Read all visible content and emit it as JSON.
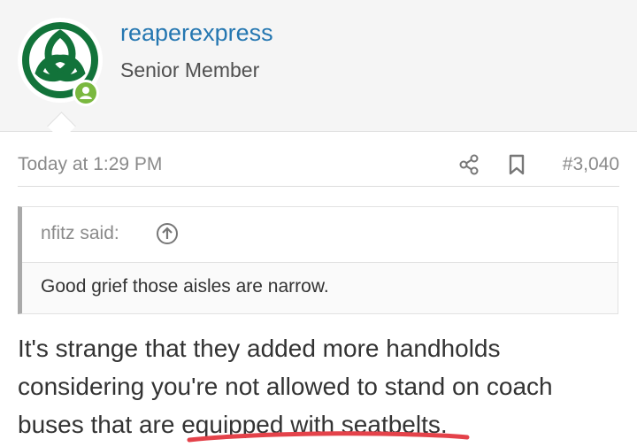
{
  "user": {
    "username": "reaperexpress",
    "title": "Senior Member",
    "avatar_icon": "green-triquetra-logo",
    "status_icon": "online-user-icon",
    "accent_color": "#2577b1",
    "logo_color": "#12733a",
    "online_color": "#7ab83f"
  },
  "post": {
    "time": "Today at 1:29 PM",
    "share_icon": "share-icon",
    "bookmark_icon": "bookmark-icon",
    "number": "#3,040",
    "quote": {
      "author": "nfitz said:",
      "arrow_icon": "arrow-up-circle-icon",
      "text": "Good grief those aisles are narrow."
    },
    "body_lines": [
      "It's strange that they added more handholds",
      "considering you're not allowed to stand on coach",
      "buses that are equipped with seatbelts."
    ],
    "annotation_color": "#e4424a"
  }
}
